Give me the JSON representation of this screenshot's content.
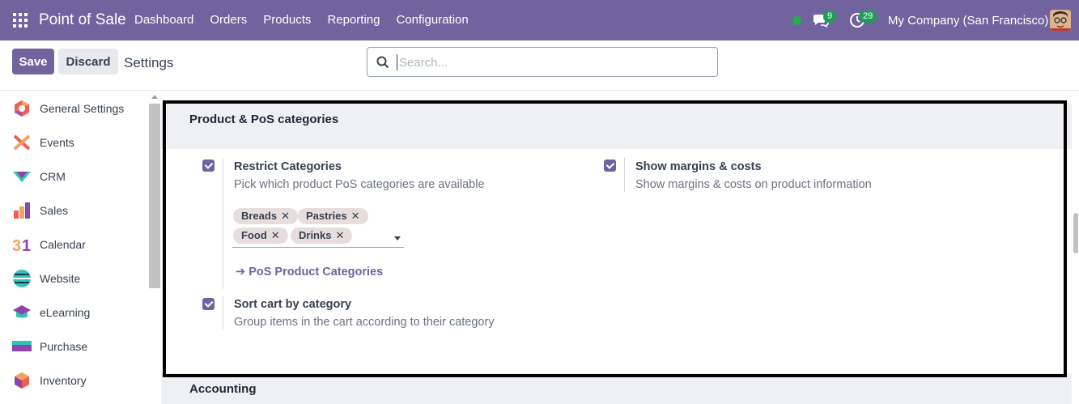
{
  "navbar": {
    "brand": "Point of Sale",
    "menu": [
      "Dashboard",
      "Orders",
      "Products",
      "Reporting",
      "Configuration"
    ],
    "chat_count": "9",
    "activity_count": "29",
    "company": "My Company (San Francisco)",
    "bg_color": "#71639e",
    "status_color": "#21b04b"
  },
  "control": {
    "save_label": "Save",
    "discard_label": "Discard",
    "title": "Settings",
    "search_placeholder": "Search..."
  },
  "sidebar": {
    "items": [
      {
        "label": "General Settings",
        "icon": "general-settings-icon"
      },
      {
        "label": "Events",
        "icon": "events-icon"
      },
      {
        "label": "CRM",
        "icon": "crm-icon"
      },
      {
        "label": "Sales",
        "icon": "sales-icon"
      },
      {
        "label": "Calendar",
        "icon": "calendar-icon"
      },
      {
        "label": "Website",
        "icon": "website-icon"
      },
      {
        "label": "eLearning",
        "icon": "elearning-icon"
      },
      {
        "label": "Purchase",
        "icon": "purchase-icon"
      },
      {
        "label": "Inventory",
        "icon": "inventory-icon"
      }
    ]
  },
  "section": {
    "title": "Product & PoS categories",
    "restrict": {
      "title": "Restrict Categories",
      "desc": "Pick which product PoS categories are available",
      "checked": true,
      "tags": [
        "Breads",
        "Pastries",
        "Food",
        "Drinks"
      ],
      "link": "PoS Product Categories"
    },
    "margins": {
      "title": "Show margins & costs",
      "desc": "Show margins & costs on product information",
      "checked": true
    },
    "sort": {
      "title": "Sort cart by category",
      "desc": "Group items in the cart according to their category",
      "checked": true
    }
  },
  "next_section": {
    "title": "Accounting"
  }
}
